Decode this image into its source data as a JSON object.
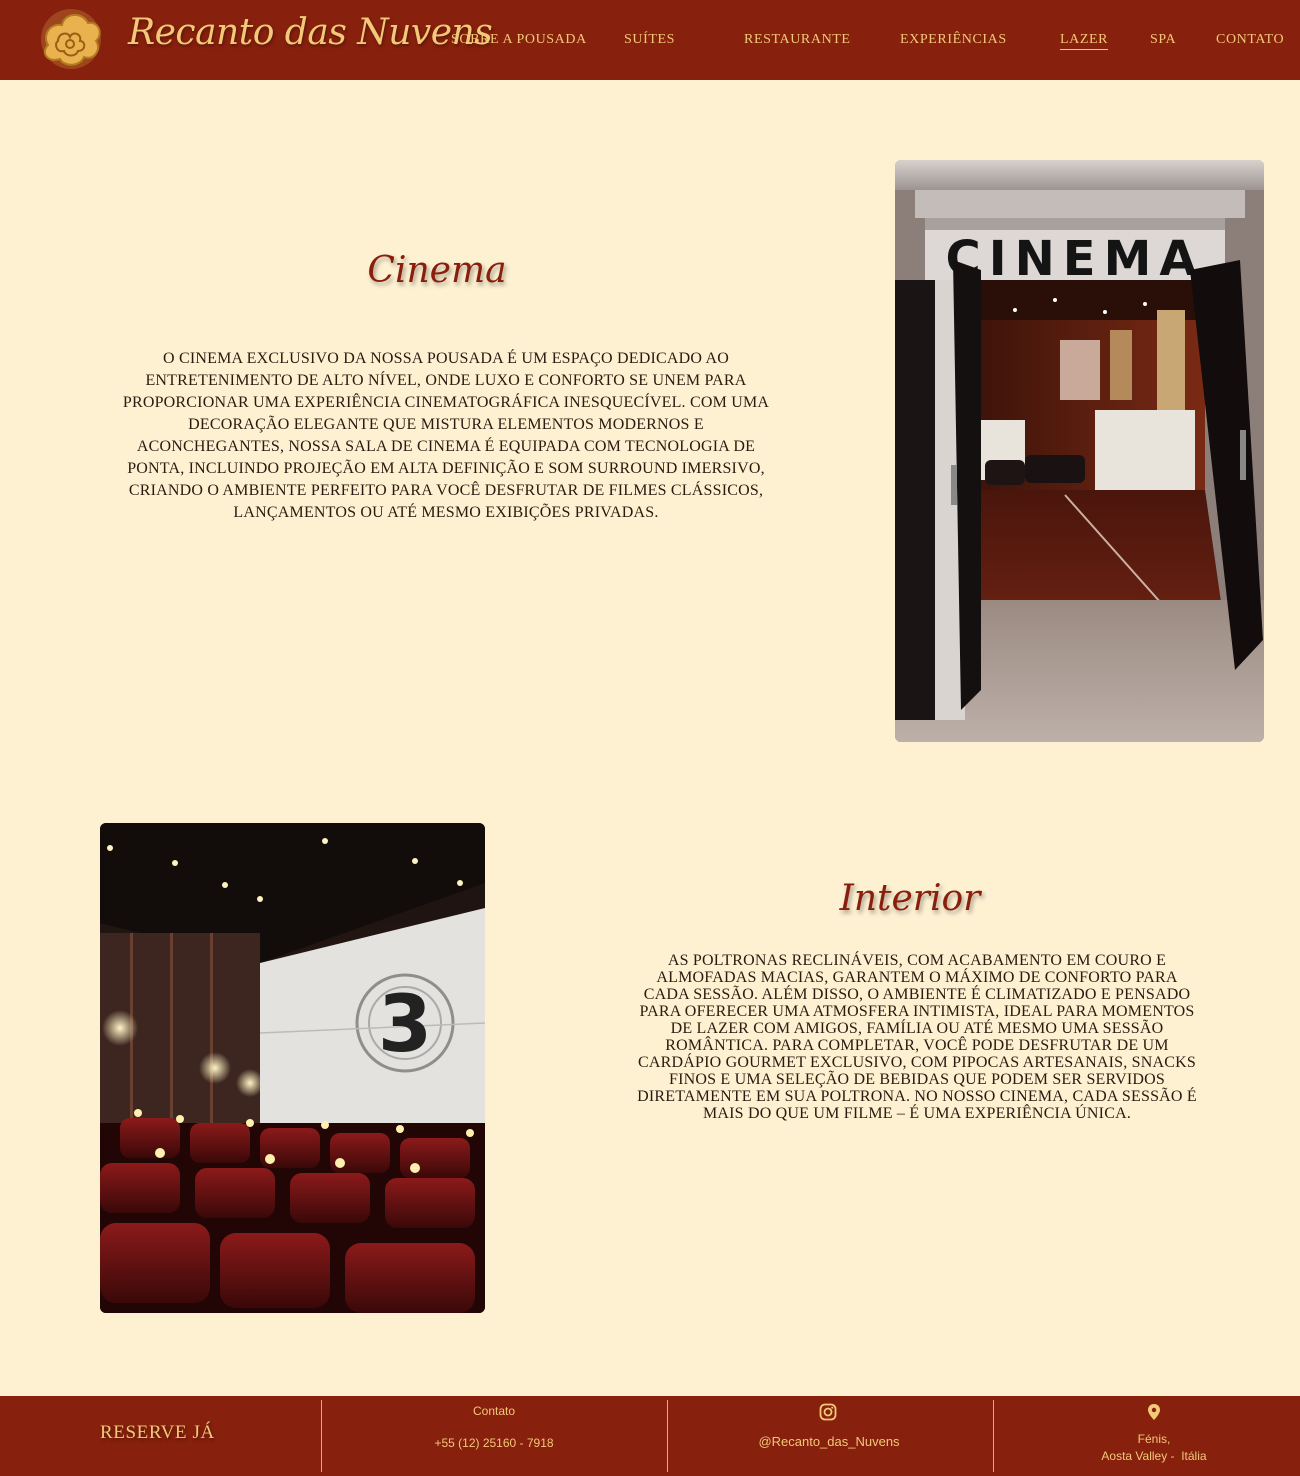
{
  "header": {
    "brand": "Recanto das Nuvens",
    "nav": [
      {
        "label": "Sobre a pousada"
      },
      {
        "label": "Suítes"
      },
      {
        "label": "Restaurante"
      },
      {
        "label": "Experiências"
      },
      {
        "label": "Lazer"
      },
      {
        "label": "Spa"
      },
      {
        "label": "Contato"
      }
    ]
  },
  "cinema": {
    "title": "Cinema",
    "text": "O cinema exclusivo da nossa pousada é um espaço dedicado ao entretenimento de alto nível, onde luxo e conforto se unem para proporcionar uma experiência cinematográfica inesquecível. Com uma decoração elegante que mistura elementos modernos e aconchegantes, nossa sala de cinema é equipada com tecnologia de ponta, incluindo projeção em alta definição e som surround imersivo, criando o ambiente perfeito para você desfrutar de filmes clássicos, lançamentos ou até mesmo exibições privadas.",
    "photo_sign": "CINEMA"
  },
  "interior": {
    "title": "Interior",
    "text": "As poltronas reclináveis, com acabamento em couro e almofadas macias, garantem o máximo de conforto para cada sessão. Além disso, o ambiente é climatizado e pensado para oferecer uma atmosfera intimista, ideal para momentos de lazer com amigos, família ou até mesmo uma sessão romântica. Para completar, você pode desfrutar de um cardápio gourmet exclusivo, com pipocas artesanais, snacks finos e uma seleção de bebidas que podem ser servidos diretamente em sua poltrona. No nosso cinema, cada sessão é mais do que um filme – é uma experiência única.",
    "countdown": "3"
  },
  "footer": {
    "reserve": "RESERVE JÁ",
    "contact_label": "Contato",
    "phone": "+55 (12) 25160 - 7918",
    "instagram": "@Recanto_das_Nuvens",
    "location_line1": "Fénis,",
    "location_line2": "Aosta Valley -  Itália"
  },
  "colors": {
    "header_bg": "#87200d",
    "page_bg": "#fdf1d2",
    "accent_gold": "#f2c978",
    "title_red": "#8a1e0c"
  },
  "icons": [
    "cloud-logo-icon",
    "instagram-icon",
    "map-pin-icon"
  ]
}
